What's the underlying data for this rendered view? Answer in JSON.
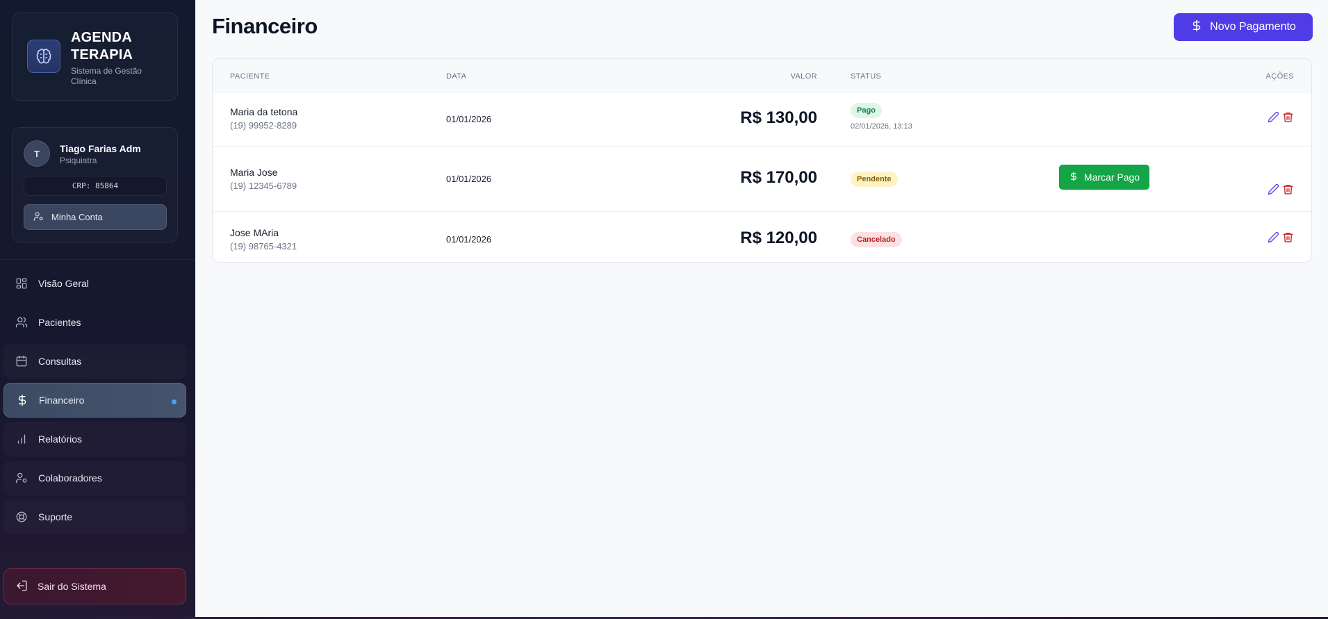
{
  "brand": {
    "title": "AGENDA TERAPIA",
    "subtitle": "Sistema de Gestão Clínica",
    "logo_icon": "brain-icon"
  },
  "user": {
    "initial": "T",
    "name": "Tiago Farias Adm",
    "role": "Psiquiatra",
    "crp": "CRP: 85864",
    "account_label": "Minha Conta"
  },
  "nav": {
    "items": [
      {
        "label": "Visão Geral",
        "icon": "grid-icon"
      },
      {
        "label": "Pacientes",
        "icon": "users-icon"
      },
      {
        "label": "Consultas",
        "icon": "calendar-icon"
      },
      {
        "label": "Financeiro",
        "icon": "dollar-icon",
        "active": true
      },
      {
        "label": "Relatórios",
        "icon": "bar-chart-icon"
      },
      {
        "label": "Colaboradores",
        "icon": "user-cog-icon"
      },
      {
        "label": "Suporte",
        "icon": "lifebuoy-icon"
      }
    ],
    "logout_label": "Sair do Sistema"
  },
  "page": {
    "title": "Financeiro",
    "new_payment_label": "Novo Pagamento"
  },
  "table": {
    "headers": {
      "patient": "PACIENTE",
      "date": "DATA",
      "value": "VALOR",
      "status": "STATUS",
      "actions": "AÇÕES"
    },
    "rows": [
      {
        "name": "Maria da tetona",
        "phone": "(19) 99952-8289",
        "date": "01/01/2026",
        "value": "R$ 130,00",
        "status": "Pago",
        "paid_at": "02/01/2026, 13:13"
      },
      {
        "name": "Maria Jose",
        "phone": "(19) 12345-6789",
        "date": "01/01/2026",
        "value": "R$ 170,00",
        "status": "Pendente",
        "action_label": "Marcar Pago"
      },
      {
        "name": "Jose MAria",
        "phone": "(19) 98765-4321",
        "date": "01/01/2026",
        "value": "R$ 120,00",
        "status": "Cancelado"
      }
    ]
  },
  "colors": {
    "accent": "#4f3ce6",
    "success": "#14a546",
    "sidebar": "#111a2e",
    "danger": "#c81e1e"
  }
}
